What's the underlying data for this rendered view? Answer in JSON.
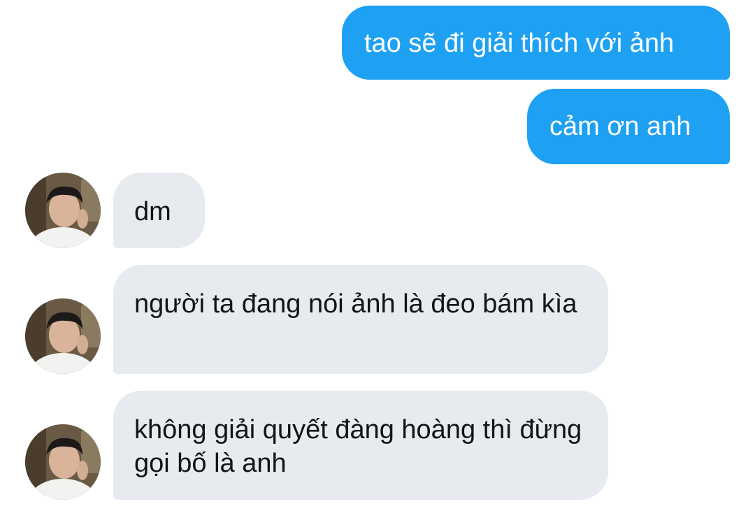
{
  "messages": [
    {
      "direction": "outgoing",
      "text": "tao sẽ đi giải thích với ảnh"
    },
    {
      "direction": "outgoing",
      "text": "cảm ơn anh"
    },
    {
      "direction": "incoming",
      "text": "dm",
      "avatar": "contact-avatar"
    },
    {
      "direction": "incoming",
      "text": "người ta đang nói ảnh là đeo bám kìa",
      "avatar": "contact-avatar"
    },
    {
      "direction": "incoming",
      "text": "không giải quyết đàng hoàng thì đừng gọi bố là anh",
      "avatar": "contact-avatar"
    }
  ],
  "colors": {
    "sent_bubble": "#1ea1f2",
    "received_bubble": "#e7ebef",
    "received_text": "#111418",
    "sent_text": "#ffffff"
  }
}
